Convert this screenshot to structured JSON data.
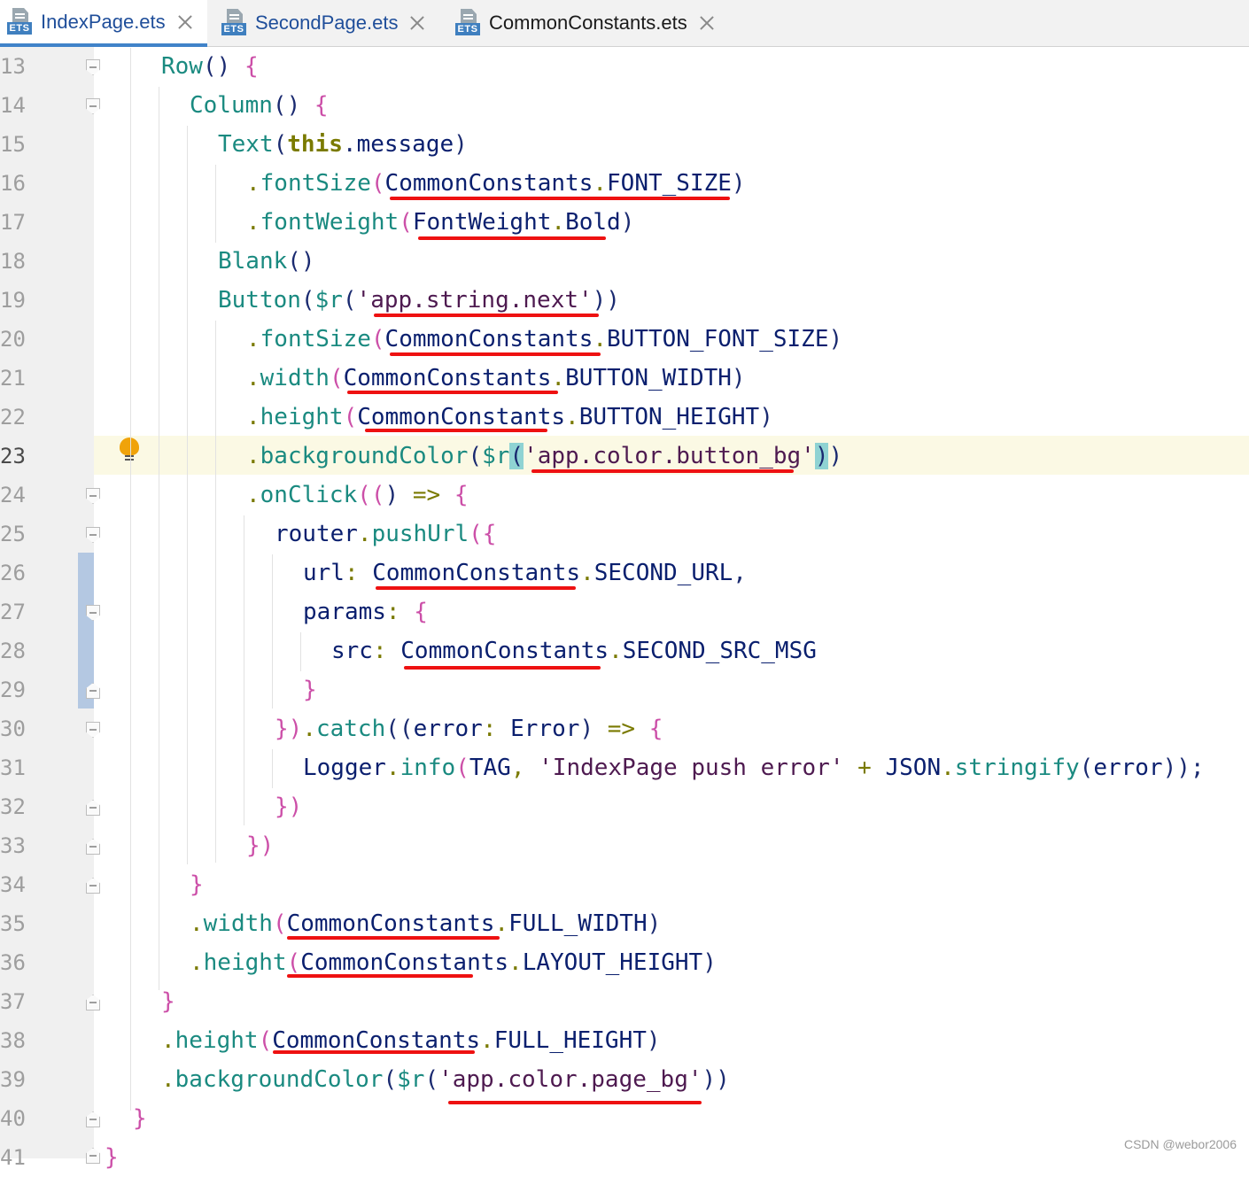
{
  "tabs": [
    {
      "label": "IndexPage.ets",
      "badge": "ETS",
      "active": true
    },
    {
      "label": "SecondPage.ets",
      "badge": "ETS",
      "active": false
    },
    {
      "label": "CommonConstants.ets",
      "badge": "ETS",
      "active": false
    }
  ],
  "line_numbers": [
    "13",
    "14",
    "15",
    "16",
    "17",
    "18",
    "19",
    "20",
    "21",
    "22",
    "23",
    "24",
    "25",
    "26",
    "27",
    "28",
    "29",
    "30",
    "31",
    "32",
    "33",
    "34",
    "35",
    "36",
    "37",
    "38",
    "39",
    "40",
    "41"
  ],
  "current_line": "23",
  "code": {
    "l13": {
      "fn": "Row",
      "p": "()",
      "b": "{"
    },
    "l14": {
      "fn": "Column",
      "p": "()",
      "b": "{"
    },
    "l15": {
      "fn": "Text",
      "open": "(",
      "kw": "this",
      "dot": ".",
      "id": "message",
      "close": ")"
    },
    "l16": {
      "dot": ".",
      "fn": "fontSize",
      "open": "(",
      "cls": "CommonConstants",
      "dot2": ".",
      "id": "FONT_SIZE",
      "close": ")"
    },
    "l17": {
      "dot": ".",
      "fn": "fontWeight",
      "open": "(",
      "cls": "FontWeight",
      "dot2": ".",
      "id": "Bold",
      "close": ")"
    },
    "l18": {
      "fn": "Blank",
      "p": "()"
    },
    "l19": {
      "fn": "Button",
      "open": "(",
      "fn2": "$r",
      "open2": "(",
      "str": "'app.string.next'",
      "close": "))"
    },
    "l20": {
      "dot": ".",
      "fn": "fontSize",
      "open": "(",
      "cls": "CommonConstants",
      "dot2": ".",
      "id": "BUTTON_FONT_SIZE",
      "close": ")"
    },
    "l21": {
      "dot": ".",
      "fn": "width",
      "open": "(",
      "cls": "CommonConstants",
      "dot2": ".",
      "id": "BUTTON_WIDTH",
      "close": ")"
    },
    "l22": {
      "dot": ".",
      "fn": "height",
      "open": "(",
      "cls": "CommonConstants",
      "dot2": ".",
      "id": "BUTTON_HEIGHT",
      "close": ")"
    },
    "l23": {
      "dot": ".",
      "fn": "backgroundColor",
      "open": "(",
      "fn2": "$r",
      "open2": "(",
      "str": "'app.color.button_bg'",
      "close2": ")",
      "close": ")"
    },
    "l24": {
      "dot": ".",
      "fn": "onClick",
      "open": "((",
      "close": ")",
      "arrow": "=>",
      "b": "{"
    },
    "l25": {
      "id": "router",
      "dot": ".",
      "fn": "pushUrl",
      "open": "({"
    },
    "l26": {
      "id": "url",
      "colon": ":",
      "cls": "CommonConstants",
      "dot": ".",
      "id2": "SECOND_URL",
      "comma": ","
    },
    "l27": {
      "id": "params",
      "colon": ":",
      "b": "{"
    },
    "l28": {
      "id": "src",
      "colon": ":",
      "cls": "CommonConstants",
      "dot": ".",
      "id2": "SECOND_SRC_MSG"
    },
    "l29": {
      "b": "}"
    },
    "l30": {
      "b": "})",
      "dot": ".",
      "fn": "catch",
      "open": "((",
      "id": "error",
      "colon": ":",
      "type": "Error",
      "close": ")",
      "arrow": "=>",
      "b2": "{"
    },
    "l31": {
      "cls": "Logger",
      "dot": ".",
      "fn": "info",
      "open": "(",
      "id": "TAG",
      "comma": ",",
      "str": "'IndexPage push error'",
      "plus": "+",
      "cls2": "JSON",
      "dot2": ".",
      "fn2": "stringify",
      "open2": "(",
      "id2": "error",
      "close": "));"
    },
    "l32": {
      "b": "})"
    },
    "l33": {
      "b": "})"
    },
    "l34": {
      "b": "}"
    },
    "l35": {
      "dot": ".",
      "fn": "width",
      "open": "(",
      "cls": "CommonConstants",
      "dot2": ".",
      "id": "FULL_WIDTH",
      "close": ")"
    },
    "l36": {
      "dot": ".",
      "fn": "height",
      "open": "(",
      "cls": "CommonConstants",
      "dot2": ".",
      "id": "LAYOUT_HEIGHT",
      "close": ")"
    },
    "l37": {
      "b": "}"
    },
    "l38": {
      "dot": ".",
      "fn": "height",
      "open": "(",
      "cls": "CommonConstants",
      "dot2": ".",
      "id": "FULL_HEIGHT",
      "close": ")"
    },
    "l39": {
      "dot": ".",
      "fn": "backgroundColor",
      "open": "(",
      "fn2": "$r",
      "open2": "(",
      "str": "'app.color.page_bg'",
      "close": "))"
    },
    "l40": {
      "b": "}"
    },
    "l41": {
      "b": "}"
    }
  },
  "watermark": "CSDN @webor2006",
  "colors": {
    "annotation_underline": "#ee1111",
    "active_tab_accent": "#4083c9",
    "current_line_bg": "#fbf9e4",
    "bulb": "#f0a30a"
  },
  "icons": [
    "ets-file-icon",
    "close-icon",
    "fold-icon",
    "lightbulb-icon"
  ]
}
